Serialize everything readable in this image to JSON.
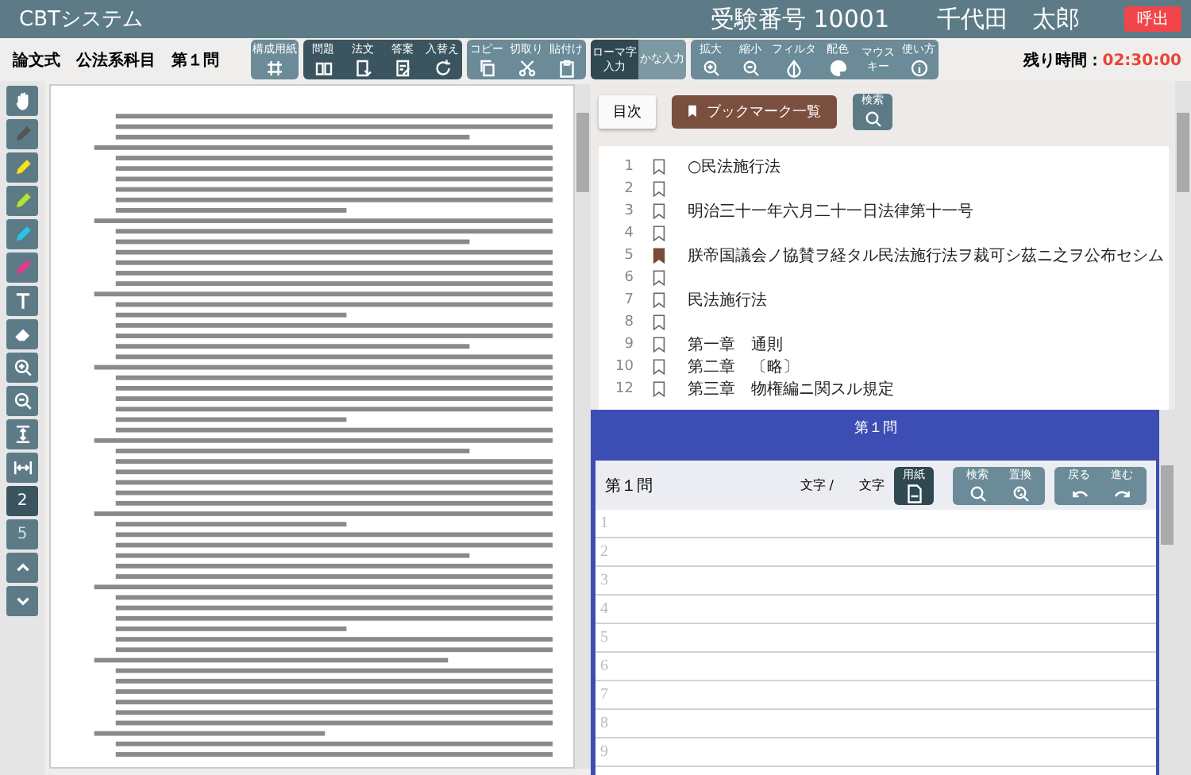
{
  "header": {
    "title": "CBTシステム",
    "exam_number": "受験番号 10001",
    "name": "千代田　太郎",
    "call_button": "呼出"
  },
  "toolbar": {
    "subject": "論文式　公法系科目　第１問",
    "groups": [
      {
        "kind": "light",
        "items": [
          {
            "label": "構成用紙"
          }
        ]
      },
      {
        "kind": "dark",
        "items": [
          {
            "label": "問題"
          },
          {
            "label": "法文"
          },
          {
            "label": "答案"
          },
          {
            "label": "入替え"
          }
        ]
      },
      {
        "kind": "light",
        "items": [
          {
            "label": "コピー"
          },
          {
            "label": "切取り"
          },
          {
            "label": "貼付け"
          }
        ]
      },
      {
        "kind": "mode",
        "items": [
          {
            "label": "ローマ字入力",
            "selected": true
          },
          {
            "label": "かな入力",
            "selected": false
          }
        ]
      },
      {
        "kind": "light",
        "items": [
          {
            "label": "拡大"
          },
          {
            "label": "縮小"
          },
          {
            "label": "フィルタ"
          },
          {
            "label": "配色"
          },
          {
            "label": "マウスキー"
          },
          {
            "label": "使い方"
          }
        ]
      }
    ],
    "timer_label": "残り時間：",
    "timer_value": "02:30:00"
  },
  "tools": {
    "pens": [
      {
        "color": "#555555"
      },
      {
        "color": "#f5e31a"
      },
      {
        "color": "#b6e32b"
      },
      {
        "color": "#27c6e8"
      },
      {
        "color": "#f0338f"
      }
    ],
    "pages": [
      {
        "label": "2",
        "selected": true
      },
      {
        "label": "5",
        "selected": false
      }
    ]
  },
  "reference": {
    "toc_button": "目次",
    "bookmark_button": "ブックマーク一覧",
    "search_button": "検索",
    "lines": [
      {
        "number": "1",
        "bookmarked": false,
        "text": "○民法施行法"
      },
      {
        "number": "2",
        "bookmarked": false
      },
      {
        "number": "3",
        "bookmarked": false,
        "text": "明治三十一年六月二十一日法律第十一号"
      },
      {
        "number": "4",
        "bookmarked": false
      },
      {
        "number": "5",
        "bookmarked": true,
        "text": "朕帝国議会ノ協賛ヲ経タル民法施行法ヲ裁可シ茲ニ之ヲ公布セシム"
      },
      {
        "number": "6",
        "bookmarked": false
      },
      {
        "number": "7",
        "bookmarked": false,
        "text": "民法施行法"
      },
      {
        "number": "8",
        "bookmarked": false
      },
      {
        "number": "9",
        "bookmarked": false,
        "text": "第一章　通則"
      },
      {
        "number": "10",
        "bookmarked": false,
        "text": "第二章　〔略〕"
      },
      {
        "number": "12",
        "bookmarked": false,
        "text": "第三章　物権編ニ関スル規定"
      }
    ]
  },
  "answer": {
    "window_title": "第１問",
    "heading": "第１問",
    "char_count_label": "文字 /",
    "char_limit_label": "文字",
    "paper_button": "用紙",
    "search_button": "検索",
    "replace_button": "置換",
    "undo_button": "戻る",
    "redo_button": "進む",
    "lines": [
      "1",
      "2",
      "3",
      "4",
      "5",
      "6",
      "7",
      "8",
      "9"
    ]
  }
}
